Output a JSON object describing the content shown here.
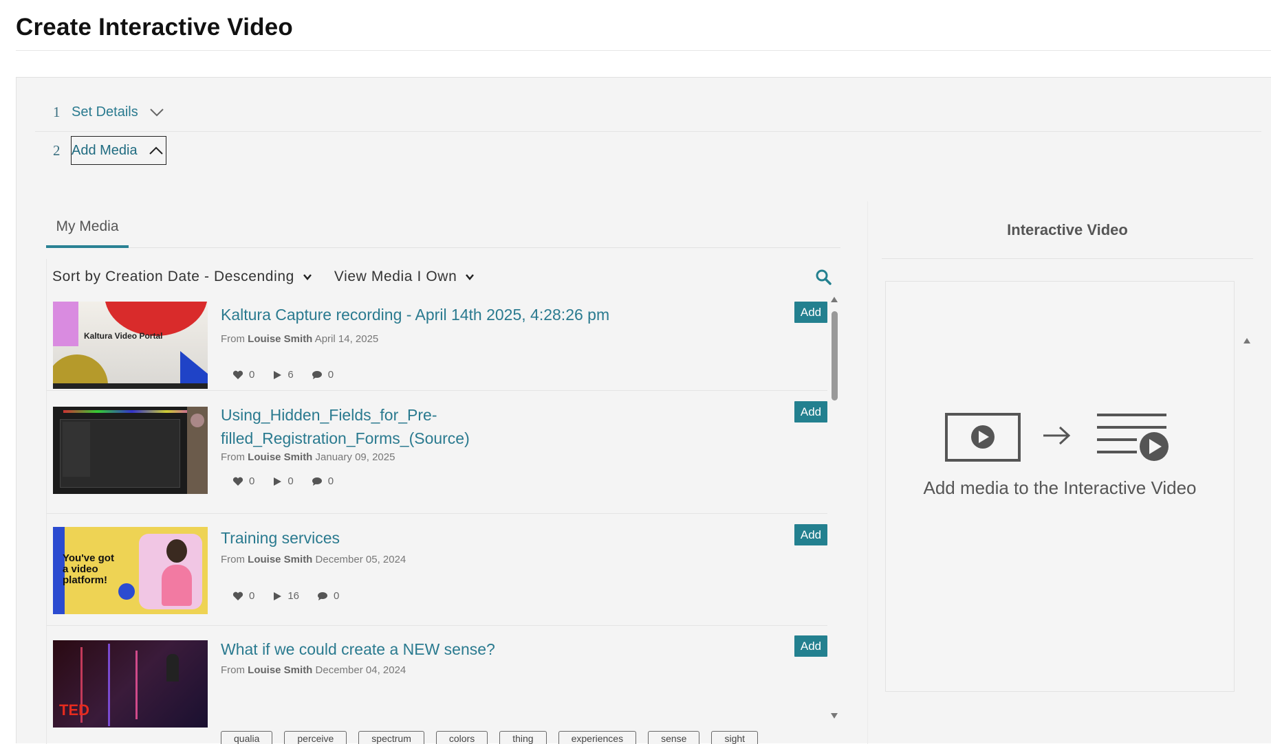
{
  "page": {
    "title": "Create Interactive Video"
  },
  "steps": [
    {
      "number": "1",
      "label": "Set Details",
      "state": "collapsed"
    },
    {
      "number": "2",
      "label": "Add Media",
      "state": "expanded"
    }
  ],
  "tabs": {
    "my_media": "My Media"
  },
  "toolbar": {
    "sort_label": "Sort by Creation Date - Descending",
    "view_label": "View Media I Own"
  },
  "media": [
    {
      "title": "Kaltura Capture recording - April 14th 2025, 4:28:26 pm",
      "from": "From",
      "owner": "Louise Smith",
      "date": "April 14, 2025",
      "likes": "0",
      "plays": "6",
      "comments": "0",
      "add": "Add",
      "thumb_text": "Kaltura Video Portal"
    },
    {
      "title_line1": "Using_Hidden_Fields_for_Pre-",
      "title_line2": "filled_Registration_Forms_(Source)",
      "from": "From",
      "owner": "Louise Smith",
      "date": "January 09, 2025",
      "likes": "0",
      "plays": "0",
      "comments": "0",
      "add": "Add"
    },
    {
      "title": "Training services",
      "from": "From",
      "owner": "Louise Smith",
      "date": "December 05, 2024",
      "likes": "0",
      "plays": "16",
      "comments": "0",
      "add": "Add",
      "thumb_text1": "You've got",
      "thumb_text2": "a video",
      "thumb_text3": "platform!"
    },
    {
      "title": "What if we could create a NEW sense?",
      "from": "From",
      "owner": "Louise Smith",
      "date": "December 04, 2024",
      "add": "Add",
      "thumb_text": "TED",
      "tags": [
        "qualia",
        "perceive",
        "spectrum",
        "colors",
        "thing",
        "experiences",
        "sense",
        "sight"
      ]
    }
  ],
  "right_panel": {
    "title": "Interactive Video",
    "empty_text": "Add media to the Interactive Video"
  },
  "colors": {
    "accent": "#23808f",
    "link": "#2a7a8f"
  }
}
